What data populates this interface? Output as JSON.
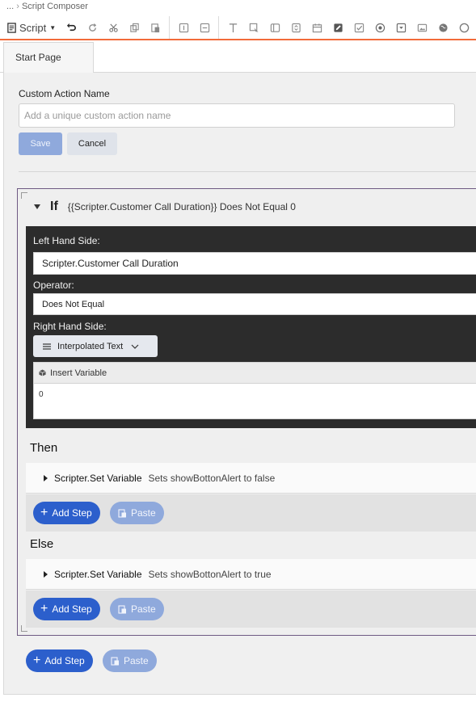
{
  "breadcrumb": {
    "prefix": "...",
    "current": "Script Composer"
  },
  "toolbar": {
    "script_label": "Script",
    "icons": [
      "undo-icon",
      "redo-icon",
      "cut-icon",
      "copy-icon",
      "paste-icon",
      "text-input-icon",
      "text-area-icon",
      "text-icon",
      "link-icon",
      "panel-icon",
      "number-icon",
      "date-icon",
      "edit-icon",
      "checkbox-icon",
      "radio-icon",
      "dropdown-icon",
      "image-icon",
      "web-icon",
      "more-icon"
    ]
  },
  "tabs": [
    {
      "label": "Start Page"
    }
  ],
  "form": {
    "name_label": "Custom Action Name",
    "name_placeholder": "Add a unique custom action name",
    "name_value": "",
    "save_label": "Save",
    "cancel_label": "Cancel"
  },
  "if_block": {
    "keyword": "If",
    "summary": "{{Scripter.Customer Call Duration}} Does Not Equal 0",
    "lhs_label": "Left Hand Side:",
    "lhs_value": "Scripter.Customer Call Duration",
    "operator_label": "Operator:",
    "operator_value": "Does Not Equal",
    "rhs_label": "Right Hand Side:",
    "rhs_mode": "Interpolated Text",
    "insert_variable_label": "Insert Variable",
    "rhs_value": "0",
    "then_label": "Then",
    "then_step": {
      "name": "Scripter.Set Variable",
      "desc": "Sets showBottonAlert to false"
    },
    "else_label": "Else",
    "else_step": {
      "name": "Scripter.Set Variable",
      "desc": "Sets showBottonAlert to true"
    }
  },
  "actions": {
    "add_step_label": "Add Step",
    "paste_label": "Paste"
  },
  "colors": {
    "accent_orange": "#f26b3a",
    "primary_blue": "#2c5fcc",
    "disabled_blue": "#8fa9dc",
    "condition_dark": "#2c2c2c",
    "if_border": "#6f5a84"
  }
}
